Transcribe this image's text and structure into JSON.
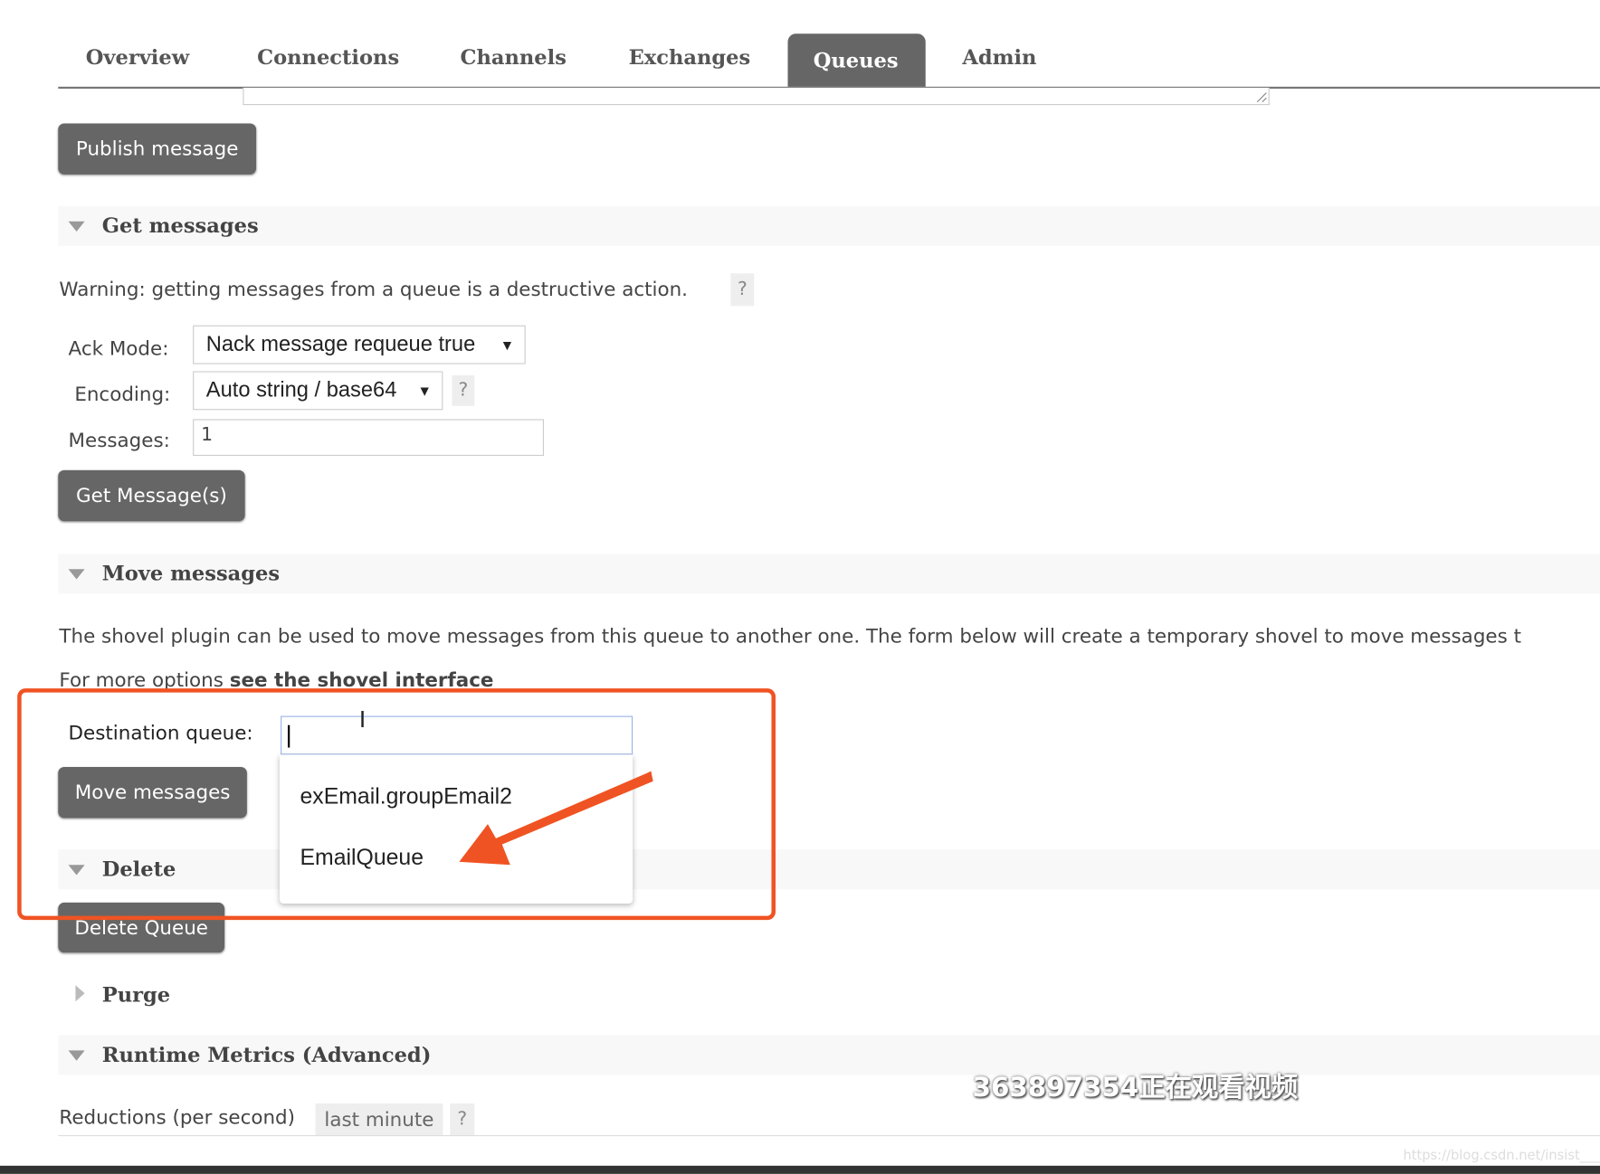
{
  "nav": {
    "tabs": [
      {
        "label": "Overview"
      },
      {
        "label": "Connections"
      },
      {
        "label": "Channels"
      },
      {
        "label": "Exchanges"
      },
      {
        "label": "Queues",
        "active": true
      },
      {
        "label": "Admin"
      }
    ]
  },
  "publish": {
    "button": "Publish message"
  },
  "get_messages": {
    "title": "Get messages",
    "warning": "Warning: getting messages from a queue is a destructive action.",
    "help": "?",
    "ack_mode_label": "Ack Mode:",
    "ack_mode_value": "Nack message requeue true",
    "encoding_label": "Encoding:",
    "encoding_value": "Auto string / base64",
    "messages_label": "Messages:",
    "messages_value": "1",
    "button": "Get Message(s)"
  },
  "move_messages": {
    "title": "Move messages",
    "description": "The shovel plugin can be used to move messages from this queue to another one. The form below will create a temporary shovel to move messages t",
    "more_prefix": "For more options ",
    "more_link": "see the shovel interface",
    "dest_label": "Destination queue:",
    "dest_value": "",
    "button": "Move messages",
    "suggestions": [
      "exEmail.groupEmail2",
      "EmailQueue"
    ]
  },
  "delete": {
    "title": "Delete",
    "button": "Delete Queue"
  },
  "purge": {
    "title": "Purge"
  },
  "runtime": {
    "title": "Runtime Metrics (Advanced)",
    "reductions_label": "Reductions (per second)",
    "range": "last minute",
    "help": "?"
  },
  "overlay": {
    "viewer_watermark": "363897354正在观看视频",
    "site_watermark": "https://blog.csdn.net/insist___"
  },
  "colors": {
    "button_bg": "#666666",
    "highlight": "#f05323",
    "active_tab": "#666666"
  }
}
